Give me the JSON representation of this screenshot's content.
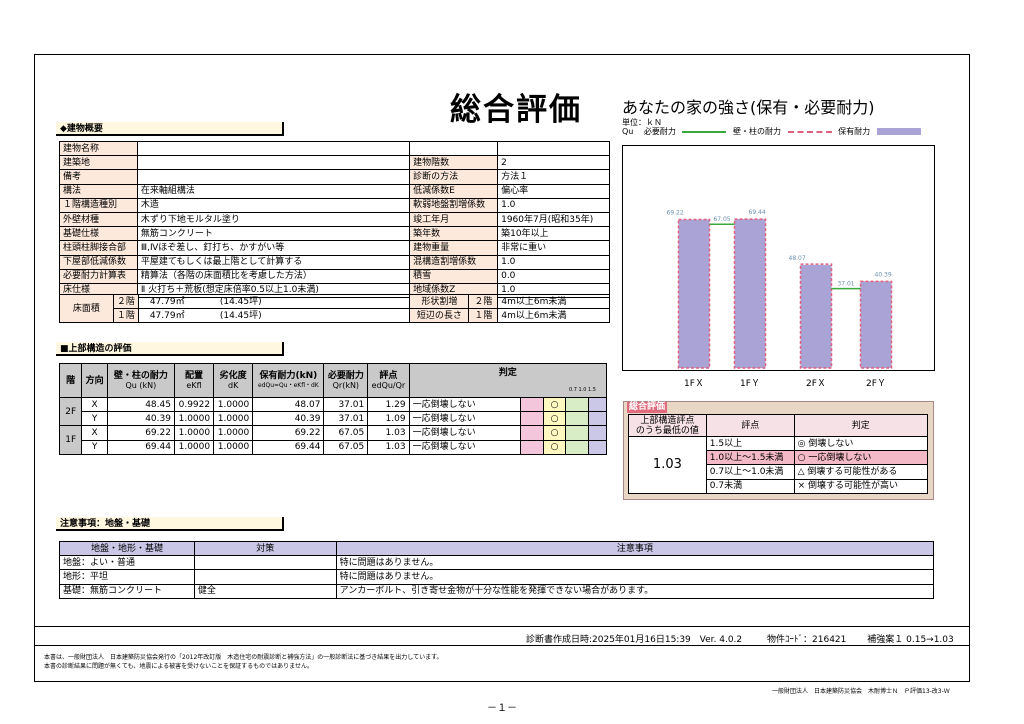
{
  "title": "総合評価",
  "subtitle": "あなたの家の強さ(保有・必要耐力)",
  "building": {
    "section_title": "◆建物概要",
    "rows": [
      {
        "l1": "建物名称",
        "v1": "",
        "l2": "",
        "v2": ""
      },
      {
        "l1": "建築地",
        "v1": "",
        "l2": "建物階数",
        "v2": "2"
      },
      {
        "l1": "備考",
        "v1": "",
        "l2": "診断の方法",
        "v2": "方法１"
      },
      {
        "l1": "構法",
        "v1": "在来軸組構法",
        "l2": "低減係数E",
        "v2": "偏心率"
      },
      {
        "l1": "１階構造種別",
        "v1": "木造",
        "l2": "軟弱地盤割増係数",
        "v2": "1.0"
      },
      {
        "l1": "外壁材種",
        "v1": "木ずり下地モルタル塗り",
        "l2": "竣工年月",
        "v2": "1960年7月(昭和35年)"
      },
      {
        "l1": "基礎仕様",
        "v1": "無筋コンクリート",
        "l2": "築年数",
        "v2": "築10年以上"
      },
      {
        "l1": "柱頭柱脚接合部",
        "v1": "Ⅲ,Ⅳほぞ差し、釘打ち、かすがい等",
        "l2": "建物重量",
        "v2": "非常に重い"
      },
      {
        "l1": "下屋部低減係数",
        "v1": "平屋建てもしくは最上階として計算する",
        "l2": "混構造割増係数",
        "v2": "1.0"
      },
      {
        "l1": "必要耐力計算表",
        "v1": "精算法（各階の床面積比を考慮した方法）",
        "l2": "積雪",
        "v2": "0.0"
      },
      {
        "l1": "床仕様",
        "v1": "Ⅱ 火打ち＋荒板(想定床倍率0.5以上1.0未満)",
        "l2": "地域係数Z",
        "v2": "1.0"
      }
    ],
    "floor_area_label": "床面積",
    "floor2_label": "２階",
    "floor2_area": "47.79㎡",
    "floor2_tsubo": "(14.45坪)",
    "floor1_label": "１階",
    "floor1_area": "47.79㎡",
    "floor1_tsubo": "(14.45坪)",
    "shape_label": "形状割増",
    "shape_floor": "２階",
    "shape_value": "4m以上6m未満",
    "short_label": "短辺の長さ",
    "short_floor": "１階",
    "short_value": "4m以上6m未満"
  },
  "upper": {
    "section_title": "■上部構造の評価",
    "headers": {
      "floor": "階",
      "dir": "方向",
      "wall": "壁・柱の耐力",
      "wall_sub": "Qu (kN)",
      "layout": "配置",
      "layout_sub": "eKfl",
      "deg": "劣化度",
      "deg_sub": "dK",
      "hold": "保有耐力(kN)",
      "hold_sub": "edQu=Qu・eKfl・dK",
      "need": "必要耐力",
      "need_sub": "Qr(kN)",
      "score": "評点",
      "score_sub": "edQu/Qr",
      "judge": "判定",
      "scale": "0.7 1.0   1.5"
    },
    "rows": [
      {
        "floor": "2F",
        "dir": "X",
        "qu": "48.45",
        "ek": "0.9922",
        "dk": "1.0000",
        "hold": "48.07",
        "need": "37.01",
        "score": "1.29",
        "judge": "一応倒壊しない",
        "mark": "○"
      },
      {
        "floor": "",
        "dir": "Y",
        "qu": "40.39",
        "ek": "1.0000",
        "dk": "1.0000",
        "hold": "40.39",
        "need": "37.01",
        "score": "1.09",
        "judge": "一応倒壊しない",
        "mark": "○"
      },
      {
        "floor": "1F",
        "dir": "X",
        "qu": "69.22",
        "ek": "1.0000",
        "dk": "1.0000",
        "hold": "69.22",
        "need": "67.05",
        "score": "1.03",
        "judge": "一応倒壊しない",
        "mark": "○"
      },
      {
        "floor": "",
        "dir": "Y",
        "qu": "69.44",
        "ek": "1.0000",
        "dk": "1.0000",
        "hold": "69.44",
        "need": "67.05",
        "score": "1.03",
        "judge": "一応倒壊しない",
        "mark": "○"
      }
    ]
  },
  "chart_data": {
    "type": "bar",
    "unit_label": "単位：ｋＮ",
    "legend_qu": "Qu",
    "legend_need": "必要耐力",
    "legend_wall": "壁・柱の耐力",
    "legend_hold": "保有耐力",
    "categories": [
      "1FＸ",
      "1FＹ",
      "2FＸ",
      "2FＹ"
    ],
    "series": [
      {
        "name": "保有耐力",
        "values": [
          69.22,
          69.44,
          48.07,
          40.39
        ],
        "color": "#a9a3d6"
      },
      {
        "name": "壁・柱の耐力",
        "values": [
          69.22,
          69.44,
          48.45,
          40.39
        ],
        "color": "#e0607e"
      },
      {
        "name": "必要耐力",
        "values": [
          67.05,
          67.05,
          37.01,
          37.01
        ],
        "color": "#3aa83a"
      }
    ],
    "value_labels": [
      "69.22",
      "69.44",
      "48.07",
      "40.39"
    ],
    "need_labels": [
      "67.05",
      "37.01"
    ],
    "ylim": [
      0,
      90
    ]
  },
  "overall": {
    "title": "総合評価",
    "col1": "上部構造評点\nのうち最低の値",
    "col1_a": "上部構造評点",
    "col1_b": "のうち最低の値",
    "col2": "評点",
    "col3": "判定",
    "value": "1.03",
    "rows": [
      {
        "range": "1.5以上",
        "judge": "◎ 倒壊しない"
      },
      {
        "range": "1.0以上～1.5未満",
        "judge": "○ 一応倒壊しない"
      },
      {
        "range": "0.7以上～1.0未満",
        "judge": "△ 倒壊する可能性がある"
      },
      {
        "range": "0.7未満",
        "judge": "× 倒壊する可能性が高い"
      }
    ]
  },
  "notes": {
    "section_title": "注意事項：地盤・基礎",
    "headers": [
      "地盤・地形・基礎",
      "対策",
      "注意事項"
    ],
    "rows": [
      {
        "a": "地盤：よい・普通",
        "b": "",
        "c": "特に問題はありません。"
      },
      {
        "a": "地形：平坦",
        "b": "",
        "c": "特に問題はありません。"
      },
      {
        "a": "基礎：無筋コンクリート",
        "b": "健全",
        "c": "アンカーボルト、引き寄せ金物が十分な性能を発揮できない場合があります。"
      }
    ]
  },
  "footer": {
    "date": "診断書作成日時:2025年01月16日15:39",
    "version": "Ver. 4.0.2",
    "code": "物件ｺｰﾄﾞ：216421",
    "plan": "補強案１ 0.15→1.03",
    "note1": "本書は、一般財団法人　日本建築防災協会発行の「2012年改訂版　木造住宅の耐震診断と補強方法」の一般診断法に基づき結果を出力しています。",
    "note2": "本書の診断結果に問題が無くても、地震による被害を受けないことを保証するものではありません。",
    "credit": "一般財団法人　日本建築防災協会　木耐博士Ｎ　Ｐ評価13-改3-Ｗ",
    "page": "－１－"
  }
}
